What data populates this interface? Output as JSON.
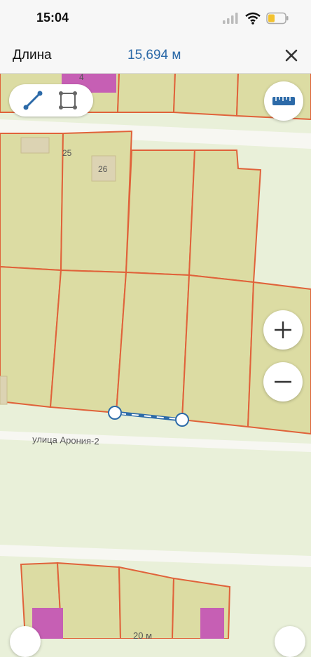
{
  "status_bar": {
    "time": "15:04",
    "icons": [
      "cellular-signal-icon",
      "wifi-icon",
      "battery-icon"
    ]
  },
  "header": {
    "label": "Длина",
    "value": "15,694 м",
    "close_icon": "close-icon"
  },
  "toolbar": {
    "tools": [
      "line-measure-icon",
      "area-measure-icon"
    ],
    "ruler_icon": "ruler-icon"
  },
  "map": {
    "street_name": "улица Арония-2",
    "plot_numbers": [
      "4",
      "25",
      "26"
    ],
    "scale_label": "20 м",
    "colors": {
      "background": "#e9f0d9",
      "parcel_fill": "#dcdca3",
      "parcel_border": "#e0623a",
      "building_fill": "#dcd3b3",
      "building_pink": "#c65fb4",
      "road": "#f7f7f2",
      "measure_line": "#2c6aa8"
    }
  },
  "controls": {
    "zoom_in_icon": "plus-icon",
    "zoom_out_icon": "minus-icon"
  }
}
